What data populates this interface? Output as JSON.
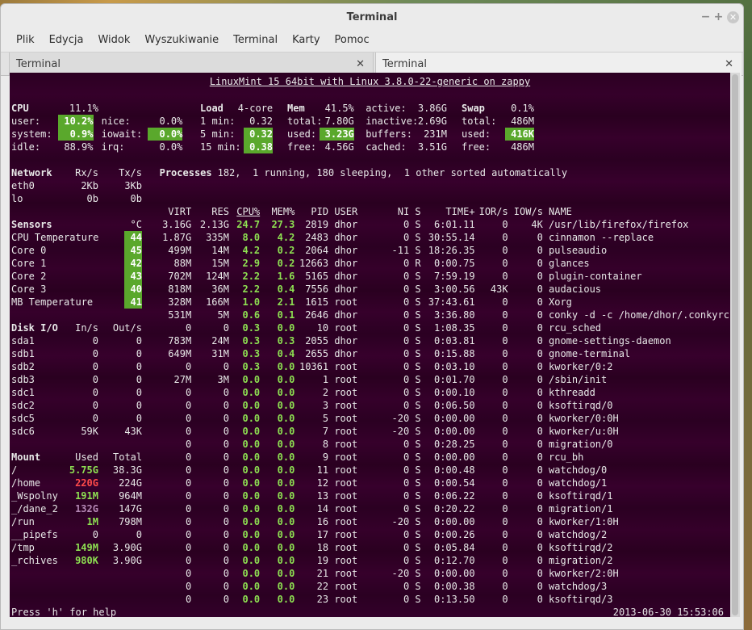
{
  "window": {
    "title": "Terminal",
    "menu": [
      "Plik",
      "Edycja",
      "Widok",
      "Wyszukiwanie",
      "Terminal",
      "Karty",
      "Pomoc"
    ],
    "tabs": [
      {
        "label": "Terminal",
        "active": false
      },
      {
        "label": "Terminal",
        "active": true
      }
    ]
  },
  "glances": {
    "header": "LinuxMint 15 64bit with Linux 3.8.0-22-generic on zappy",
    "cpu": {
      "title": "CPU",
      "pct": "11.1%",
      "user": "10.2%",
      "nice": "0.0%",
      "system": "0.9%",
      "iowait": "0.0%",
      "idle": "88.9%",
      "irq": "0.0%",
      "labels": {
        "user": "user:",
        "nice": "nice:",
        "system": "system:",
        "iowait": "iowait:",
        "idle": "idle:",
        "irq": "irq:"
      }
    },
    "load": {
      "title": "Load",
      "cores": "4-core",
      "l1_label": "1 min:",
      "l1": "0.32",
      "l5_label": "5 min:",
      "l5": "0.32",
      "l15_label": "15 min:",
      "l15": "0.38"
    },
    "mem": {
      "title": "Mem",
      "pct": "41.5%",
      "total_label": "total:",
      "total": "7.80G",
      "used_label": "used:",
      "used": "3.23G",
      "free_label": "free:",
      "free": "4.56G",
      "active_label": "active:",
      "active": "3.86G",
      "inactive_label": "inactive:",
      "inactive": "2.69G",
      "buffers_label": "buffers:",
      "buffers": "231M",
      "cached_label": "cached:",
      "cached": "3.51G"
    },
    "swap": {
      "title": "Swap",
      "pct": "0.1%",
      "total_label": "total:",
      "total": "486M",
      "used_label": "used:",
      "used": "416K",
      "free_label": "free:",
      "free": "486M"
    },
    "network": {
      "title": "Network",
      "rx": "Rx/s",
      "tx": "Tx/s",
      "rows": [
        [
          "eth0",
          "2Kb",
          "3Kb"
        ],
        [
          "lo",
          "0b",
          "0b"
        ]
      ]
    },
    "processes": {
      "title": "Processes",
      "summary": "182,  1 running, 180 sleeping,  1 other sorted automatically"
    },
    "sensors": {
      "title": "Sensors",
      "unit": "°C",
      "rows": [
        [
          "CPU Temperature",
          "44"
        ],
        [
          "Core 0",
          "45"
        ],
        [
          "Core 1",
          "42"
        ],
        [
          "Core 2",
          "43"
        ],
        [
          "Core 3",
          "40"
        ],
        [
          "MB Temperature",
          "41"
        ]
      ]
    },
    "diskio": {
      "title": "Disk I/O",
      "in": "In/s",
      "out": "Out/s",
      "rows": [
        [
          "sda1",
          "0",
          "0"
        ],
        [
          "sdb1",
          "0",
          "0"
        ],
        [
          "sdb2",
          "0",
          "0"
        ],
        [
          "sdb3",
          "0",
          "0"
        ],
        [
          "sdc1",
          "0",
          "0"
        ],
        [
          "sdc2",
          "0",
          "0"
        ],
        [
          "sdc5",
          "0",
          "0"
        ],
        [
          "sdc6",
          "59K",
          "43K"
        ]
      ]
    },
    "mount": {
      "title": "Mount",
      "used": "Used",
      "total": "Total",
      "rows": [
        [
          "/",
          "5.75G",
          "38.3G",
          "g"
        ],
        [
          "/home",
          "220G",
          "224G",
          "red"
        ],
        [
          "_Wspolny",
          "191M",
          "964M",
          "g"
        ],
        [
          "_/dane_2",
          "132G",
          "147G",
          "pur"
        ],
        [
          "/run",
          "1M",
          "798M",
          "g"
        ],
        [
          "__pipefs",
          "0",
          "0",
          ""
        ],
        [
          "/tmp",
          "149M",
          "3.90G",
          "g"
        ],
        [
          "_rchives",
          "980K",
          "3.90G",
          "g"
        ]
      ]
    },
    "proc_header": [
      "VIRT",
      "RES",
      "CPU%",
      "MEM%",
      "PID",
      "USER",
      "NI",
      "S",
      "TIME+",
      "IOR/s",
      "IOW/s",
      "NAME"
    ],
    "procs": [
      [
        "3.16G",
        "2.13G",
        "24.7",
        "27.3",
        "2819",
        "dhor",
        "0",
        "S",
        "6:01.11",
        "0",
        "4K",
        "/usr/lib/firefox/firefox"
      ],
      [
        "1.87G",
        "335M",
        "8.0",
        "4.2",
        "2483",
        "dhor",
        "0",
        "S",
        "30:55.14",
        "0",
        "0",
        "cinnamon --replace"
      ],
      [
        "499M",
        "14M",
        "4.2",
        "0.2",
        "2064",
        "dhor",
        "-11",
        "S",
        "18:26.35",
        "0",
        "0",
        "pulseaudio"
      ],
      [
        "88M",
        "15M",
        "2.9",
        "0.2",
        "12663",
        "dhor",
        "0",
        "R",
        "0:00.75",
        "0",
        "0",
        "glances"
      ],
      [
        "702M",
        "124M",
        "2.2",
        "1.6",
        "5165",
        "dhor",
        "0",
        "S",
        "7:59.19",
        "0",
        "0",
        "plugin-container"
      ],
      [
        "818M",
        "36M",
        "2.2",
        "0.4",
        "7556",
        "dhor",
        "0",
        "S",
        "3:00.56",
        "43K",
        "0",
        "audacious"
      ],
      [
        "328M",
        "166M",
        "1.0",
        "2.1",
        "1615",
        "root",
        "0",
        "S",
        "37:43.61",
        "0",
        "0",
        "Xorg"
      ],
      [
        "531M",
        "5M",
        "0.6",
        "0.1",
        "2646",
        "dhor",
        "0",
        "S",
        "3:36.80",
        "0",
        "0",
        "conky -d -c /home/dhor/.conkyrc"
      ],
      [
        "0",
        "0",
        "0.3",
        "0.0",
        "10",
        "root",
        "0",
        "S",
        "1:08.35",
        "0",
        "0",
        "rcu_sched"
      ],
      [
        "783M",
        "24M",
        "0.3",
        "0.3",
        "2055",
        "dhor",
        "0",
        "S",
        "0:03.81",
        "0",
        "0",
        "gnome-settings-daemon"
      ],
      [
        "649M",
        "31M",
        "0.3",
        "0.4",
        "2655",
        "dhor",
        "0",
        "S",
        "0:15.88",
        "0",
        "0",
        "gnome-terminal"
      ],
      [
        "0",
        "0",
        "0.3",
        "0.0",
        "10361",
        "root",
        "0",
        "S",
        "0:03.10",
        "0",
        "0",
        "kworker/0:2"
      ],
      [
        "27M",
        "3M",
        "0.0",
        "0.0",
        "1",
        "root",
        "0",
        "S",
        "0:01.70",
        "0",
        "0",
        "/sbin/init"
      ],
      [
        "0",
        "0",
        "0.0",
        "0.0",
        "2",
        "root",
        "0",
        "S",
        "0:00.10",
        "0",
        "0",
        "kthreadd"
      ],
      [
        "0",
        "0",
        "0.0",
        "0.0",
        "3",
        "root",
        "0",
        "S",
        "0:06.50",
        "0",
        "0",
        "ksoftirqd/0"
      ],
      [
        "0",
        "0",
        "0.0",
        "0.0",
        "5",
        "root",
        "-20",
        "S",
        "0:00.00",
        "0",
        "0",
        "kworker/0:0H"
      ],
      [
        "0",
        "0",
        "0.0",
        "0.0",
        "7",
        "root",
        "-20",
        "S",
        "0:00.00",
        "0",
        "0",
        "kworker/u:0H"
      ],
      [
        "0",
        "0",
        "0.0",
        "0.0",
        "8",
        "root",
        "0",
        "S",
        "0:28.25",
        "0",
        "0",
        "migration/0"
      ],
      [
        "0",
        "0",
        "0.0",
        "0.0",
        "9",
        "root",
        "0",
        "S",
        "0:00.00",
        "0",
        "0",
        "rcu_bh"
      ],
      [
        "0",
        "0",
        "0.0",
        "0.0",
        "11",
        "root",
        "0",
        "S",
        "0:00.48",
        "0",
        "0",
        "watchdog/0"
      ],
      [
        "0",
        "0",
        "0.0",
        "0.0",
        "12",
        "root",
        "0",
        "S",
        "0:00.54",
        "0",
        "0",
        "watchdog/1"
      ],
      [
        "0",
        "0",
        "0.0",
        "0.0",
        "13",
        "root",
        "0",
        "S",
        "0:06.22",
        "0",
        "0",
        "ksoftirqd/1"
      ],
      [
        "0",
        "0",
        "0.0",
        "0.0",
        "14",
        "root",
        "0",
        "S",
        "0:20.22",
        "0",
        "0",
        "migration/1"
      ],
      [
        "0",
        "0",
        "0.0",
        "0.0",
        "16",
        "root",
        "-20",
        "S",
        "0:00.00",
        "0",
        "0",
        "kworker/1:0H"
      ],
      [
        "0",
        "0",
        "0.0",
        "0.0",
        "17",
        "root",
        "0",
        "S",
        "0:00.26",
        "0",
        "0",
        "watchdog/2"
      ],
      [
        "0",
        "0",
        "0.0",
        "0.0",
        "18",
        "root",
        "0",
        "S",
        "0:05.84",
        "0",
        "0",
        "ksoftirqd/2"
      ],
      [
        "0",
        "0",
        "0.0",
        "0.0",
        "19",
        "root",
        "0",
        "S",
        "0:12.70",
        "0",
        "0",
        "migration/2"
      ],
      [
        "0",
        "0",
        "0.0",
        "0.0",
        "21",
        "root",
        "-20",
        "S",
        "0:00.00",
        "0",
        "0",
        "kworker/2:0H"
      ],
      [
        "0",
        "0",
        "0.0",
        "0.0",
        "22",
        "root",
        "0",
        "S",
        "0:00.38",
        "0",
        "0",
        "watchdog/3"
      ],
      [
        "0",
        "0",
        "0.0",
        "0.0",
        "23",
        "root",
        "0",
        "S",
        "0:13.50",
        "0",
        "0",
        "ksoftirqd/3"
      ]
    ],
    "help": "Press 'h' for help",
    "datetime": "2013-06-30 15:53:06"
  }
}
